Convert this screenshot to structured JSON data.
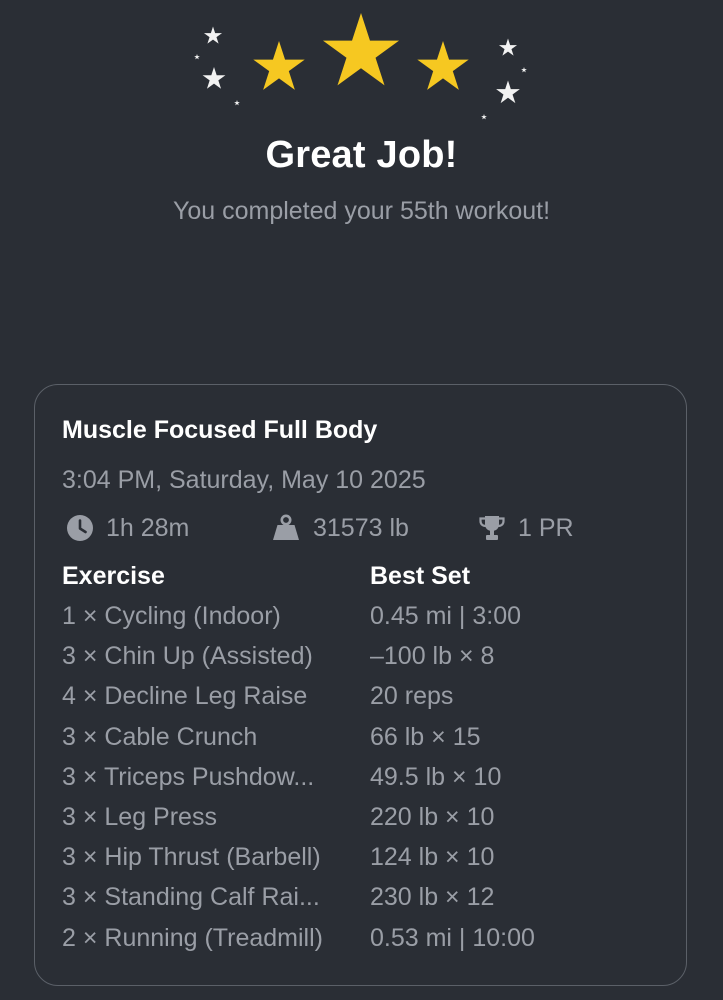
{
  "header": {
    "title": "Great Job!",
    "subtitle": "You completed your 55th workout!"
  },
  "colors": {
    "background": "#2a2e35",
    "star_gold": "#f6c821",
    "star_white": "#f2f2f2",
    "text_primary": "#ffffff",
    "text_secondary": "#9a9ea6",
    "card_border": "#5b6068"
  },
  "workout": {
    "name": "Muscle Focused Full Body",
    "datetime": "3:04 PM, Saturday, May 10 2025",
    "stats": {
      "duration": {
        "icon": "clock-icon",
        "value": "1h 28m"
      },
      "volume": {
        "icon": "weight-icon",
        "value": "31573 lb"
      },
      "prs": {
        "icon": "trophy-icon",
        "value": "1 PR"
      }
    },
    "columns": {
      "exercise": "Exercise",
      "best_set": "Best Set"
    },
    "exercises": [
      {
        "name": "1 × Cycling (Indoor)",
        "best": "0.45 mi | 3:00"
      },
      {
        "name": "3 × Chin Up (Assisted)",
        "best": "–100 lb × 8"
      },
      {
        "name": "4 × Decline Leg Raise",
        "best": "20 reps"
      },
      {
        "name": "3 × Cable Crunch",
        "best": "66 lb × 15"
      },
      {
        "name": "3 × Triceps Pushdow...",
        "best": "49.5 lb × 10"
      },
      {
        "name": "3 × Leg Press",
        "best": "220 lb × 10"
      },
      {
        "name": "3 × Hip Thrust (Barbell)",
        "best": "124 lb × 10"
      },
      {
        "name": "3 × Standing Calf Rai...",
        "best": "230 lb × 12"
      },
      {
        "name": "2 × Running (Treadmill)",
        "best": "0.53 mi | 10:00"
      }
    ]
  }
}
